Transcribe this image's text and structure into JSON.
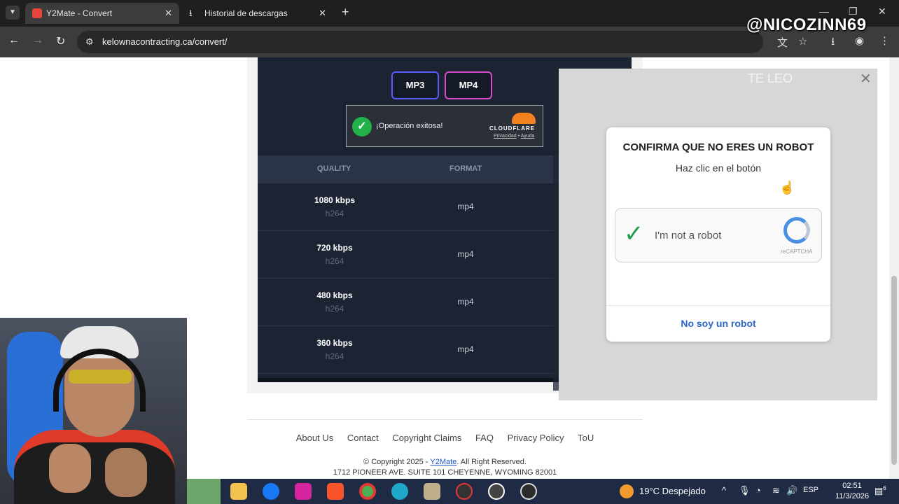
{
  "browser": {
    "tabs": [
      {
        "title": "Y2Mate - Convert",
        "active": true
      },
      {
        "title": "Historial de descargas",
        "active": false
      }
    ],
    "url": "kelownacontracting.ca/convert/"
  },
  "watermark": "@NICOZINN69",
  "converter": {
    "mp3_label": "MP3",
    "mp4_label": "MP4",
    "cloudflare": {
      "status": "¡Operación exitosa!",
      "brand": "CLOUDFLARE",
      "privacy": "Privacidad",
      "separator": "•",
      "help": "Ayuda"
    },
    "table": {
      "headers": [
        "QUALITY",
        "FORMAT"
      ],
      "rows": [
        {
          "quality": "1080 kbps",
          "codec": "h264",
          "format": "mp4"
        },
        {
          "quality": "720 kbps",
          "codec": "h264",
          "format": "mp4"
        },
        {
          "quality": "480 kbps",
          "codec": "h264",
          "format": "mp4"
        },
        {
          "quality": "360 kbps",
          "codec": "h264",
          "format": "mp4"
        }
      ]
    }
  },
  "overlay": {
    "brand": "TE LEO",
    "close": "✕",
    "title": "CONFIRMA QUE NO ERES UN ROBOT",
    "subtitle": "Haz clic en el botón",
    "recaptcha_label": "I'm not a robot",
    "recaptcha_brand": "reCAPTCHA",
    "link": "No soy un robot"
  },
  "footer": {
    "links": [
      "About Us",
      "Contact",
      "Copyright Claims",
      "FAQ",
      "Privacy Policy",
      "ToU"
    ],
    "copyright_prefix": "© Copyright 2025 - ",
    "brand_link": "Y2Mate",
    "copyright_suffix": ". All Right Reserved.",
    "address": "1712 PIONEER AVE. SUITE 101 CHEYENNE, WYOMING 82001"
  },
  "taskbar": {
    "weather": "19°C  Despejado",
    "language": "ESP",
    "time": "02:51",
    "date": "11/3/2026",
    "notifications": "6"
  },
  "colors": {
    "panel": "#1c2433",
    "accent_mp3": "#5b5bff",
    "accent_mp4": "#d94cd0",
    "success": "#21b24a",
    "link": "#2a66c9"
  }
}
